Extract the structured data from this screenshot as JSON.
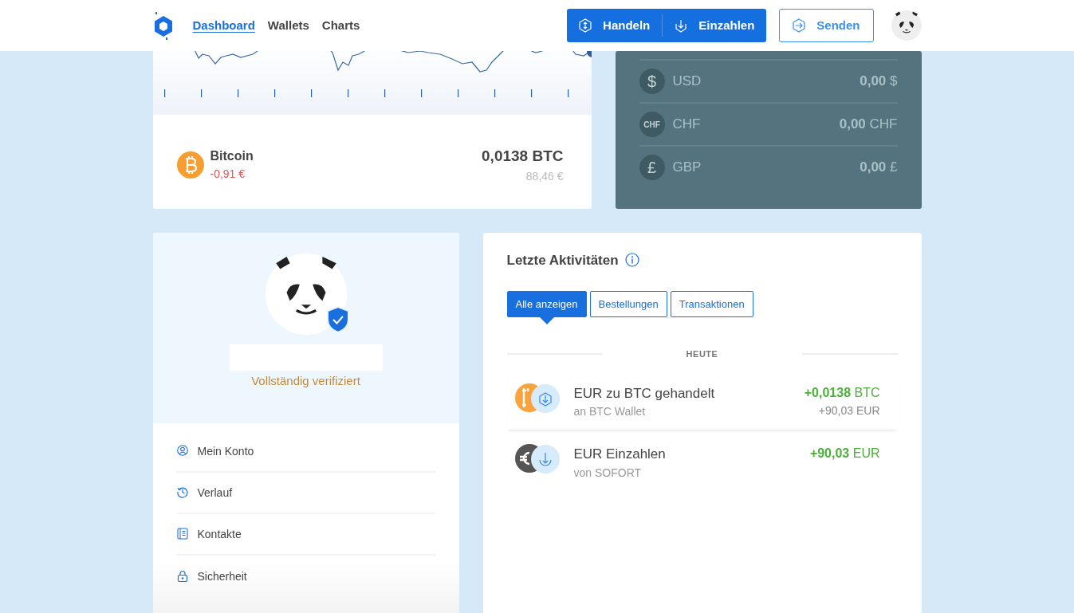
{
  "nav": {
    "links": [
      {
        "label": "Dashboard",
        "selected": true
      },
      {
        "label": "Wallets",
        "selected": false
      },
      {
        "label": "Charts",
        "selected": false
      }
    ],
    "actions": [
      {
        "kind": "trade",
        "label": "Handeln"
      },
      {
        "kind": "deposit",
        "label": "Einzahlen"
      }
    ],
    "send": {
      "label": "Senden"
    }
  },
  "wallet": {
    "name": "Bitcoin",
    "change": "-0,91 €",
    "amount": "0,0138 BTC",
    "value": "88,46 €"
  },
  "fiat": [
    {
      "symbol": "$",
      "code": "USD",
      "amount": "0,00",
      "unit": "$"
    },
    {
      "symbol": "CHF",
      "code": "CHF",
      "amount": "0,00",
      "unit": "CHF"
    },
    {
      "symbol": "£",
      "code": "GBP",
      "amount": "0,00",
      "unit": "£"
    }
  ],
  "profile": {
    "verified": true,
    "status": "Vollständig verifiziert",
    "menu": [
      {
        "kind": "account",
        "label": "Mein Konto"
      },
      {
        "kind": "history",
        "label": "Verlauf"
      },
      {
        "kind": "contacts",
        "label": "Kontakte"
      },
      {
        "kind": "security",
        "label": "Sicherheit"
      }
    ]
  },
  "activity": {
    "title": "Letzte Aktivitäten",
    "filters": [
      {
        "label": "Alle anzeigen",
        "selected": true
      },
      {
        "label": "Bestellungen",
        "selected": false
      },
      {
        "label": "Transaktionen",
        "selected": false
      }
    ],
    "section": "HEUTE",
    "items": [
      {
        "kind": "trade",
        "title": "EUR zu BTC gehandelt",
        "subtitle": "an BTC Wallet",
        "amount": "+0,0138",
        "unit": "BTC",
        "secondary": "+90,03 EUR"
      },
      {
        "kind": "deposit",
        "title": "EUR Einzahlen",
        "subtitle": "von SOFORT",
        "amount": "+90,03",
        "unit": "EUR"
      }
    ]
  }
}
